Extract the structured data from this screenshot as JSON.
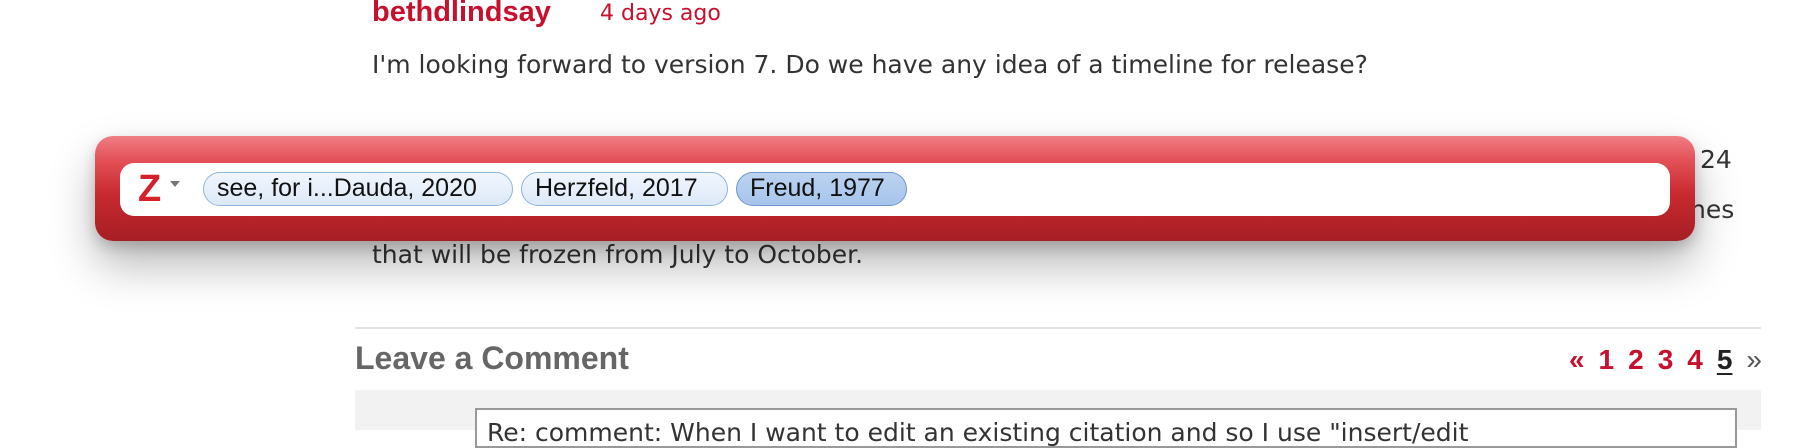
{
  "comment": {
    "author": "bethdlindsay",
    "date": "4 days ago",
    "text_line1": "I'm looking forward to version 7. Do we have any idea of a timeline for release?",
    "text_line_last": "that will be frozen from July to October.",
    "partial_tail_1": "24",
    "partial_tail_2": "nes"
  },
  "leave_comment": {
    "title": "Leave a Comment",
    "pager": {
      "prev": "«",
      "pages": [
        "1",
        "2",
        "3",
        "4",
        "5"
      ],
      "current": "5",
      "next": "»"
    },
    "textarea_value": "Re: comment: When I want to edit an existing citation and so I use \"insert/edit"
  },
  "zotero_bar": {
    "logo_icon": "zotero-z-logo-icon",
    "citations": [
      "see, for i...Dauda, 2020",
      "Herzfeld, 2017",
      "Freud, 1977"
    ],
    "selected_citation_index": 2,
    "colors": {
      "bar_top": "#ef7f84",
      "bar_bottom": "#a61e24",
      "bubble_border": "#8fb3df",
      "bubble_selected": "#a6c4ec"
    }
  },
  "colors": {
    "accent_red": "#c8102e",
    "heading_gray": "#666666"
  }
}
